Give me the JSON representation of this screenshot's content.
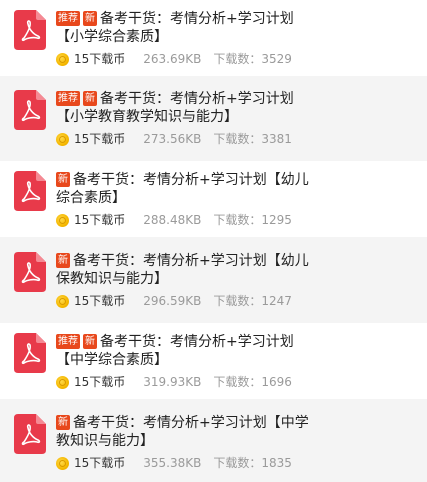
{
  "badges": {
    "recommend": "推荐",
    "new": "新"
  },
  "download_label": "下载数：",
  "items": [
    {
      "show_recommend": true,
      "title_line1": "备考干货：考情分析+学习计划",
      "title_line2": "【小学综合素质】",
      "price": "15下载币",
      "size": "263.69KB",
      "downloads": "3529"
    },
    {
      "show_recommend": true,
      "title_line1": "备考干货：考情分析+学习计划",
      "title_line2": "【小学教育教学知识与能力】",
      "price": "15下载币",
      "size": "273.56KB",
      "downloads": "3381"
    },
    {
      "show_recommend": false,
      "title_line1": "备考干货：考情分析+学习计划【幼儿",
      "title_line2": "综合素质】",
      "price": "15下载币",
      "size": "288.48KB",
      "downloads": "1295"
    },
    {
      "show_recommend": false,
      "title_line1": "备考干货：考情分析+学习计划【幼儿",
      "title_line2": "保教知识与能力】",
      "price": "15下载币",
      "size": "296.59KB",
      "downloads": "1247"
    },
    {
      "show_recommend": true,
      "title_line1": "备考干货：考情分析+学习计划",
      "title_line2": "【中学综合素质】",
      "price": "15下载币",
      "size": "319.93KB",
      "downloads": "1696"
    },
    {
      "show_recommend": false,
      "title_line1": "备考干货：考情分析+学习计划【中学",
      "title_line2": "教知识与能力】",
      "price": "15下载币",
      "size": "355.38KB",
      "downloads": "1835"
    }
  ],
  "colors": {
    "pdf_red": "#e83a4a",
    "badge": "#e8481c",
    "coin": "#f5b800",
    "row_alt": "#f4f4f4"
  },
  "icons": {
    "file": "pdf-file-icon",
    "coin": "coin-icon"
  }
}
